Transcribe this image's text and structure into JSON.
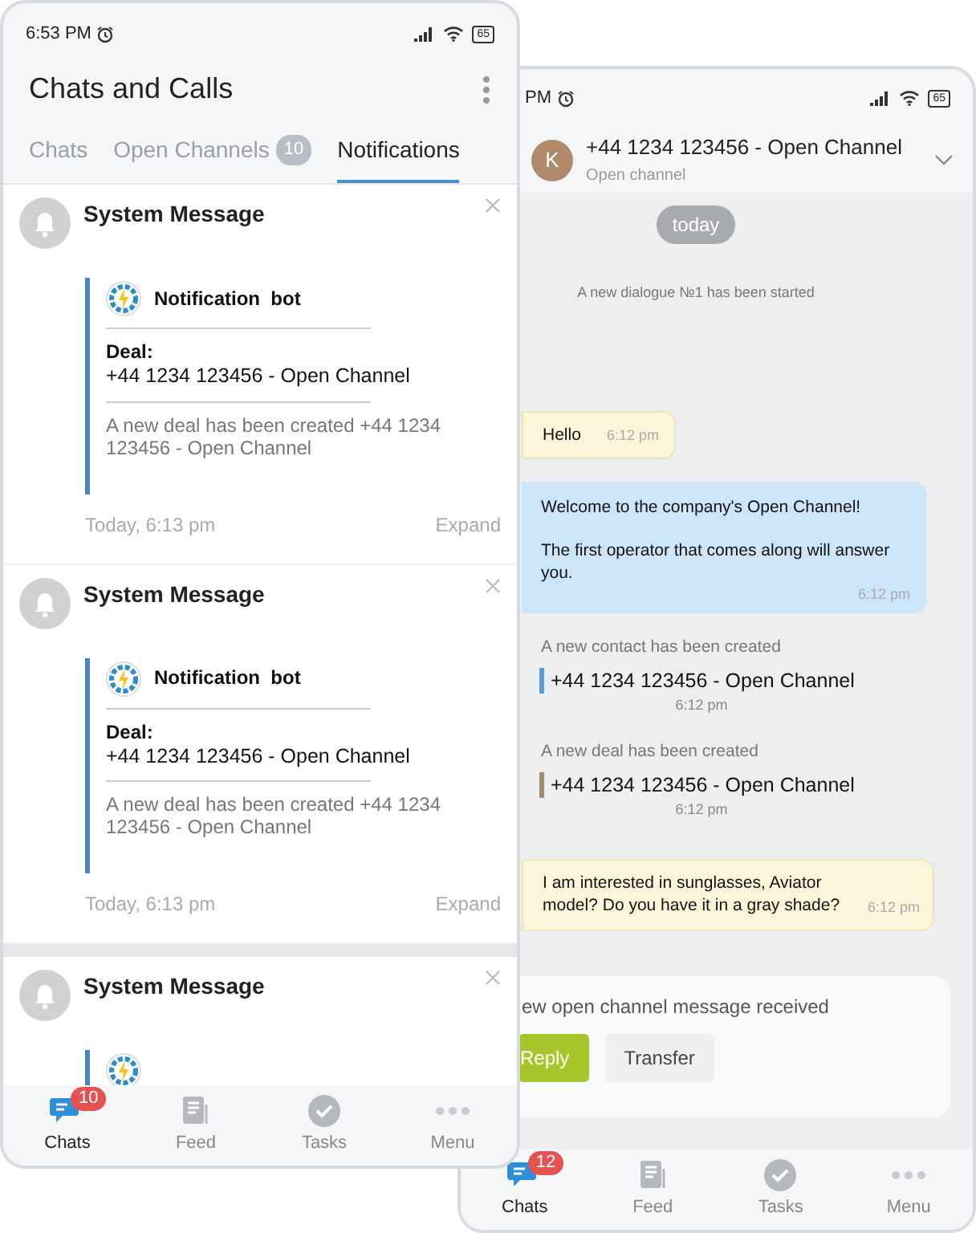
{
  "notifications_phone": {
    "status_bar": {
      "time": "6:53 PM",
      "battery": "65"
    },
    "title": "Chats and Calls",
    "tabs": [
      {
        "label": "Chats",
        "selected": false
      },
      {
        "label": "Open Channels",
        "badge": "10",
        "selected": false
      },
      {
        "label": "Notifications",
        "selected": true
      }
    ],
    "notifications": [
      {
        "title": "System Message",
        "bot_name": "Notification  bot",
        "deal_label": "Deal:",
        "deal_value": "+44 1234 123456 - Open Channel",
        "description": "A new deal has been created +44 1234 123456 - Open Channel",
        "time": "Today, 6:13 pm",
        "expand": "Expand"
      },
      {
        "title": "System Message",
        "bot_name": "Notification  bot",
        "deal_label": "Deal:",
        "deal_value": "+44 1234 123456 - Open Channel",
        "description": "A new deal has been created +44 1234 123456 - Open Channel",
        "time": "Today, 6:13 pm",
        "expand": "Expand"
      },
      {
        "title": "System Message"
      }
    ],
    "nav": [
      {
        "kind": "chats",
        "label": "Chats",
        "badge": "10",
        "selected": true
      },
      {
        "kind": "feed",
        "label": "Feed",
        "selected": false
      },
      {
        "kind": "tasks",
        "label": "Tasks",
        "selected": false
      },
      {
        "kind": "menu",
        "label": "Menu",
        "selected": false
      }
    ]
  },
  "chat_phone": {
    "status_bar": {
      "time": "PM",
      "battery": "65"
    },
    "avatar": "K",
    "title": "+44 1234 123456 - Open Channel",
    "subtitle": "Open channel",
    "messages": [
      {
        "kind": "date",
        "text": "today"
      },
      {
        "kind": "system",
        "text": "A new dialogue №1 has been started"
      },
      {
        "kind": "incoming",
        "text": "Hello",
        "time": "6:12 pm"
      },
      {
        "kind": "outgoing",
        "text": "Welcome to the company's Open Channel!\n\nThe first operator that comes along will answer you.",
        "time": "6:12 pm"
      },
      {
        "kind": "entity",
        "label": "A new contact has been created",
        "value": "+44 1234 123456 - Open Channel",
        "time": "6:12 pm",
        "color": "#5b9bd5"
      },
      {
        "kind": "entity",
        "label": "A new deal has been created",
        "value": "+44 1234 123456 - Open Channel",
        "time": "6:12 pm",
        "color": "#a08a70"
      },
      {
        "kind": "incoming",
        "text": "I am interested in sunglasses, Aviator model? Do you have it in a gray shade?",
        "time": "6:12 pm"
      }
    ],
    "action_panel": {
      "text": "ew open channel message received",
      "buttons": [
        {
          "kind": "primary",
          "label": "Reply"
        },
        {
          "kind": "secondary",
          "label": "Transfer"
        }
      ]
    },
    "nav": [
      {
        "kind": "chats",
        "label": "Chats",
        "badge": "12",
        "selected": true
      },
      {
        "kind": "feed",
        "label": "Feed",
        "selected": false
      },
      {
        "kind": "tasks",
        "label": "Tasks",
        "selected": false
      },
      {
        "kind": "menu",
        "label": "Menu",
        "selected": false
      }
    ]
  }
}
